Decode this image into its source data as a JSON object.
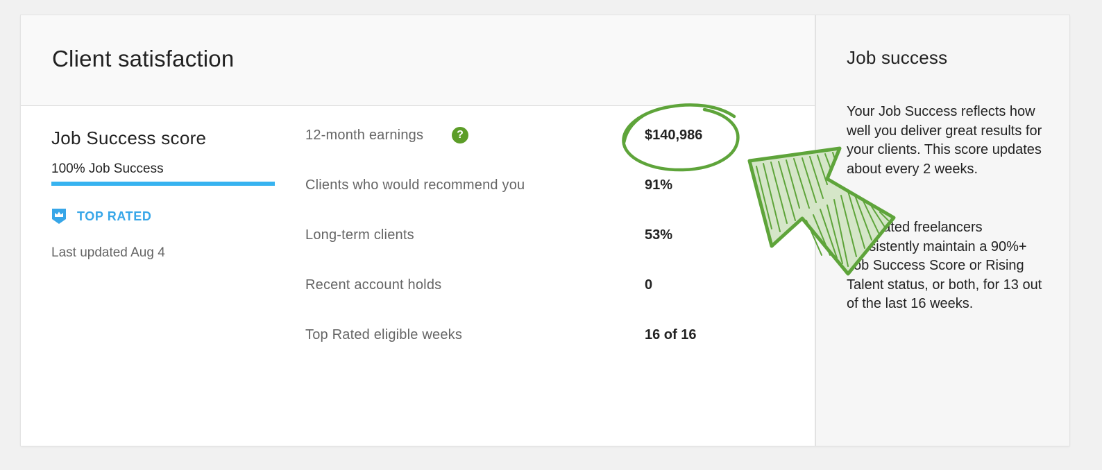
{
  "header": {
    "title": "Client satisfaction"
  },
  "job_success": {
    "title": "Job Success score",
    "label": "100% Job Success",
    "progress_fraction": 1.0,
    "badge_label": "TOP RATED",
    "last_updated": "Last updated Aug 4"
  },
  "metrics": [
    {
      "label": "12-month earnings",
      "value": "$140,986",
      "help": "?"
    },
    {
      "label": "Clients who would recommend you",
      "value": "91%"
    },
    {
      "label": "Long-term clients",
      "value": "53%"
    },
    {
      "label": "Recent account holds",
      "value": "0"
    },
    {
      "label": "Top Rated eligible weeks",
      "value": "16 of 16"
    }
  ],
  "sidebar": {
    "title": "Job success",
    "paragraph_1": "Your Job Success reflects how well you deliver great results for your clients. This score updates about every 2 weeks.",
    "paragraph_2": "Top Rated freelancers consistently maintain a 90%+ Job Success Score or Rising Talent status, or both, for 13 out of the last 16 weeks."
  },
  "colors": {
    "accent_blue": "#37b3f0",
    "badge_blue": "#37a6e8",
    "help_green": "#5c9d28",
    "annotation_green": "#5ea43a",
    "annotation_fill": "#d5e6c8"
  },
  "icons": {
    "badge": "crown-shield-icon",
    "help": "question-circle-icon",
    "annotation_circle": "highlight-circle",
    "annotation_arrow": "pointer-arrow"
  }
}
